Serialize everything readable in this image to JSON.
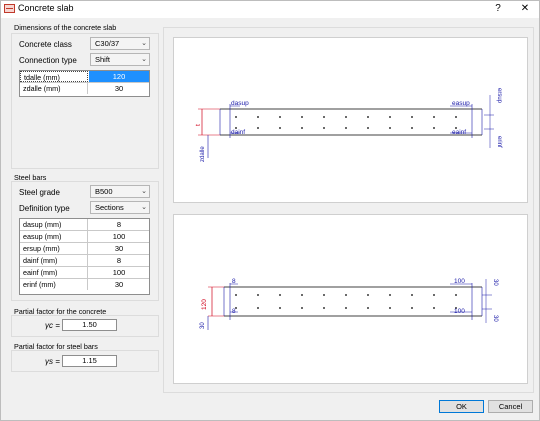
{
  "window": {
    "title": "Concrete slab",
    "help_label": "?",
    "close_label": "✕"
  },
  "dimensions": {
    "title": "Dimensions of the concrete slab",
    "concrete_class_label": "Concrete class",
    "concrete_class_value": "C30/37",
    "connection_type_label": "Connection type",
    "connection_type_value": "Shift",
    "rows": [
      {
        "name": "tdalle (mm)",
        "value": "120"
      },
      {
        "name": "zdalle (mm)",
        "value": "30"
      }
    ]
  },
  "steel_bars": {
    "title": "Steel bars",
    "steel_grade_label": "Steel grade",
    "steel_grade_value": "B500",
    "definition_type_label": "Definition type",
    "definition_type_value": "Sections",
    "rows": [
      {
        "name": "dasup (mm)",
        "value": "8"
      },
      {
        "name": "easup (mm)",
        "value": "100"
      },
      {
        "name": "ersup (mm)",
        "value": "30"
      },
      {
        "name": "dainf (mm)",
        "value": "8"
      },
      {
        "name": "eainf (mm)",
        "value": "100"
      },
      {
        "name": "erinf (mm)",
        "value": "30"
      }
    ]
  },
  "partial_concrete": {
    "title": "Partial factor for the concrete",
    "symbol": "γc =",
    "value": "1.50"
  },
  "partial_steel": {
    "title": "Partial factor for steel bars",
    "symbol": "γs =",
    "value": "1.15"
  },
  "diagram_top": {
    "dasup": "dasup",
    "dainf": "dainf",
    "easup": "easup",
    "eainf": "eainf",
    "ersup": "ersup",
    "erinf": "erinf",
    "zdalle": "zdalle",
    "tdalle": "t"
  },
  "diagram_bottom": {
    "d_top": "8",
    "d_bot": "8",
    "e_top": "100",
    "e_bot": "100",
    "r_top": "30",
    "r_bot": "30",
    "z": "30",
    "t": "120"
  },
  "buttons": {
    "ok": "OK",
    "cancel": "Cancel"
  },
  "colors": {
    "accent": "#1e90ff",
    "dim_blue": "#1a1aa8",
    "dim_red": "#d0021b"
  }
}
